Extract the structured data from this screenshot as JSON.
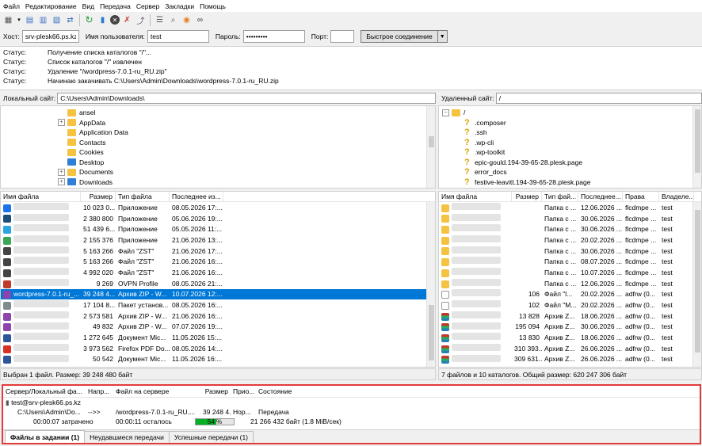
{
  "menu": [
    "Файл",
    "Редактирование",
    "Вид",
    "Передача",
    "Сервер",
    "Закладки",
    "Помощь"
  ],
  "quickconnect": {
    "host_label": "Хост:",
    "host_value": "srv-plesk66.ps.kz",
    "user_label": "Имя пользователя:",
    "user_value": "test",
    "pass_label": "Пароль:",
    "pass_value": "•••••••••",
    "port_label": "Порт:",
    "port_value": "",
    "connect_button": "Быстрое соединение"
  },
  "log": [
    {
      "k": "Статус:",
      "v": "Получение списка каталогов \"/\"..."
    },
    {
      "k": "Статус:",
      "v": "Список каталогов \"/\" извлечен"
    },
    {
      "k": "Статус:",
      "v": "Удаление \"/wordpress-7.0.1-ru_RU.zip\""
    },
    {
      "k": "Статус:",
      "v": "Начинаю закачивать C:\\Users\\Admin\\Downloads\\wordpress-7.0.1-ru_RU.zip"
    }
  ],
  "local_site": {
    "label": "Локальный сайт:",
    "path": "C:\\Users\\Admin\\Downloads\\"
  },
  "remote_site": {
    "label": "Удаленный сайт:",
    "path": "/"
  },
  "local_tree": [
    {
      "name": "ansel",
      "exp": false,
      "icon": "folder"
    },
    {
      "name": "AppData",
      "exp": true,
      "icon": "folder"
    },
    {
      "name": "Application Data",
      "exp": false,
      "icon": "folder"
    },
    {
      "name": "Contacts",
      "exp": false,
      "icon": "folder"
    },
    {
      "name": "Cookies",
      "exp": false,
      "icon": "folder"
    },
    {
      "name": "Desktop",
      "exp": false,
      "icon": "folder-blue"
    },
    {
      "name": "Documents",
      "exp": true,
      "icon": "folder"
    },
    {
      "name": "Downloads",
      "exp": true,
      "icon": "folder-blue"
    }
  ],
  "remote_tree": {
    "root": "/",
    "items": [
      ".composer",
      ".ssh",
      ".wp-cli",
      ".wp-toolkit",
      "epic-gould.194-39-65-28.plesk.page",
      "error_docs",
      "festive-leavitt.194-39-65-28.plesk.page"
    ]
  },
  "local_headers": [
    "Имя файла",
    "Размер",
    "Тип файла",
    "Последнее из..."
  ],
  "local_files": [
    {
      "name": "",
      "size": "10 023 0...",
      "type": "Приложение",
      "date": "08.05.2026 17:...",
      "color": "#1a73e8",
      "sel": false
    },
    {
      "name": "",
      "size": "2 380 800",
      "type": "Приложение",
      "date": "05.06.2026 19:...",
      "color": "#1f4e79",
      "sel": false
    },
    {
      "name": "",
      "size": "51 439 6...",
      "type": "Приложение",
      "date": "05.05.2026 11:...",
      "color": "#2ca5e0",
      "sel": false
    },
    {
      "name": "",
      "size": "2 155 376",
      "type": "Приложение",
      "date": "21.06.2026 13:...",
      "color": "#3aa757",
      "sel": false
    },
    {
      "name": "",
      "size": "5 163 266",
      "type": "Файл \"ZST\"",
      "date": "21.06.2026 17:...",
      "color": "#444444",
      "sel": false
    },
    {
      "name": "",
      "size": "5 163 266",
      "type": "Файл \"ZST\"",
      "date": "21.06.2026 16:...",
      "color": "#444444",
      "sel": false
    },
    {
      "name": "",
      "size": "4 992 020",
      "type": "Файл \"ZST\"",
      "date": "21.06.2026 16:...",
      "color": "#444444",
      "sel": false
    },
    {
      "name": "",
      "size": "9 269",
      "type": "OVPN Profile",
      "date": "08.05.2026 21:...",
      "color": "#c0392b",
      "sel": false
    },
    {
      "name": "wordpress-7.0.1-ru_...",
      "size": "39 248 4...",
      "type": "Архив ZIP - W...",
      "date": "10.07.2026 12:...",
      "color": "#8e44ad",
      "sel": true
    },
    {
      "name": "",
      "size": "17 104 8...",
      "type": "Пакет установ...",
      "date": "08.05.2026 16:...",
      "color": "#7f8c8d",
      "sel": false
    },
    {
      "name": "",
      "size": "2 573 581",
      "type": "Архив ZIP - W...",
      "date": "21.06.2026 16:...",
      "color": "#8e44ad",
      "sel": false
    },
    {
      "name": "",
      "size": "49 832",
      "type": "Архив ZIP - W...",
      "date": "07.07.2026 19:...",
      "color": "#8e44ad",
      "sel": false
    },
    {
      "name": "",
      "size": "1 272 645",
      "type": "Документ Mic...",
      "date": "11.05.2026 15:...",
      "color": "#2b579a",
      "sel": false
    },
    {
      "name": "",
      "size": "3 973 562",
      "type": "Firefox PDF Do...",
      "date": "08.05.2026 14:...",
      "color": "#d93025",
      "sel": false
    },
    {
      "name": "",
      "size": "50 542",
      "type": "Документ Mic...",
      "date": "11.05.2026 16:...",
      "color": "#2b579a",
      "sel": false
    }
  ],
  "remote_headers": [
    "Имя файла",
    "Размер",
    "Тип фай...",
    "Последнее...",
    "Права",
    "Владеле..."
  ],
  "remote_files": [
    {
      "size": "",
      "type": "Папка с ...",
      "date": "12.06.2026 ...",
      "perm": "flcdmpe ...",
      "owner": "test",
      "icon": "folder"
    },
    {
      "size": "",
      "type": "Папка с ...",
      "date": "30.06.2026 ...",
      "perm": "flcdmpe ...",
      "owner": "test",
      "icon": "folder"
    },
    {
      "size": "",
      "type": "Папка с ...",
      "date": "30.06.2026 ...",
      "perm": "flcdmpe ...",
      "owner": "test",
      "icon": "folder"
    },
    {
      "size": "",
      "type": "Папка с ...",
      "date": "20.02.2026 ...",
      "perm": "flcdmpe ...",
      "owner": "test",
      "icon": "folder"
    },
    {
      "size": "",
      "type": "Папка с ...",
      "date": "30.06.2026 ...",
      "perm": "flcdmpe ...",
      "owner": "test",
      "icon": "folder"
    },
    {
      "size": "",
      "type": "Папка с ...",
      "date": "08.07.2026 ...",
      "perm": "flcdmpe ...",
      "owner": "test",
      "icon": "folder"
    },
    {
      "size": "",
      "type": "Папка с ...",
      "date": "10.07.2026 ...",
      "perm": "flcdmpe ...",
      "owner": "test",
      "icon": "folder"
    },
    {
      "size": "",
      "type": "Папка с ...",
      "date": "12.06.2026 ...",
      "perm": "flcdmpe ...",
      "owner": "test",
      "icon": "folder"
    },
    {
      "size": "106",
      "type": "Файл \"l...",
      "date": "20.02.2026 ...",
      "perm": "adfrw (0...",
      "owner": "test",
      "icon": "file"
    },
    {
      "size": "102",
      "type": "Файл \"M...",
      "date": "20.02.2026 ...",
      "perm": "adfrw (0...",
      "owner": "test",
      "icon": "file"
    },
    {
      "size": "13 828",
      "type": "Архив Z...",
      "date": "18.06.2026 ...",
      "perm": "adfrw (0...",
      "owner": "test",
      "icon": "zip"
    },
    {
      "size": "195 094",
      "type": "Архив Z...",
      "date": "30.06.2026 ...",
      "perm": "adfrw (0...",
      "owner": "test",
      "icon": "zip"
    },
    {
      "size": "13 830",
      "type": "Архив Z...",
      "date": "18.06.2026 ...",
      "perm": "adfrw (0...",
      "owner": "test",
      "icon": "zip"
    },
    {
      "size": "310 393...",
      "type": "Архив Z...",
      "date": "26.06.2026 ...",
      "perm": "adfrw (0...",
      "owner": "test",
      "icon": "zip"
    },
    {
      "size": "309 631...",
      "type": "Архив Z...",
      "date": "26.06.2026 ...",
      "perm": "adfrw (0...",
      "owner": "test",
      "icon": "zip"
    }
  ],
  "local_status": "Выбран 1 файл. Размер: 39 248 480 байт",
  "remote_status": "7 файлов и 10 каталогов. Общий размер: 620 247 306 байт",
  "queue": {
    "headers": [
      "Сервер/Локальный фа...",
      "Напр...",
      "Файл на сервере",
      "Размер",
      "Прио...",
      "Состояние"
    ],
    "server": "test@srv-plesk66.ps.kz",
    "local": "C:\\Users\\Admin\\Do...",
    "dir": "-->>",
    "remote": "/wordpress-7.0.1-ru_RU....",
    "size": "39 248 4...",
    "prio": "Нор...",
    "state": "Передача",
    "elapsed": "00:00:07 затрачено",
    "remaining": "00:00:11 осталось",
    "progress": 54,
    "progress_label": "54 %",
    "bytes": "21 266 432 байт (1.8 MiB/сек)"
  },
  "tabs": [
    "Файлы в задании (1)",
    "Неудавшиеся передачи",
    "Успешные передачи (1)"
  ]
}
